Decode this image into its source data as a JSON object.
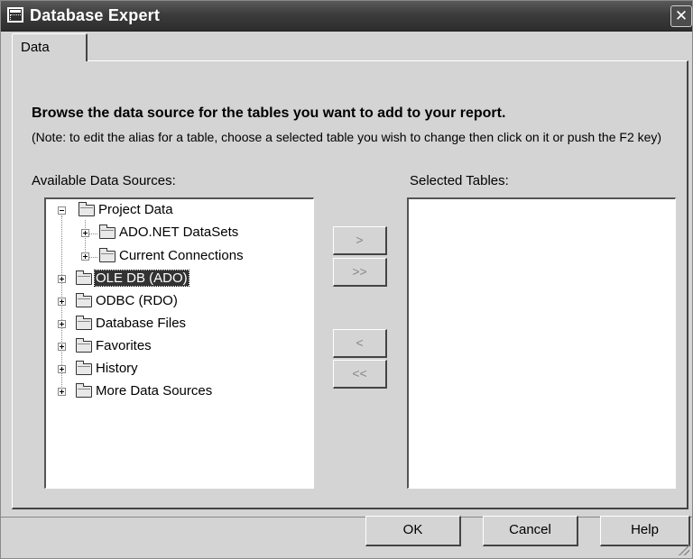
{
  "window": {
    "title": "Database Expert",
    "close_glyph": "✕"
  },
  "tabs": [
    {
      "label": "Data"
    }
  ],
  "main": {
    "heading": "Browse the data source for the tables you want to add to your report.",
    "note": "(Note: to edit the alias for a table, choose a selected table you wish to change then click on it or push the F2 key)",
    "available_label": "Available Data Sources:",
    "selected_label": "Selected Tables:"
  },
  "tree": {
    "items": [
      {
        "label": "Project Data",
        "expanded": true
      },
      {
        "label": "ADO.NET DataSets",
        "expanded": false
      },
      {
        "label": "Current Connections",
        "expanded": false
      },
      {
        "label": "OLE DB (ADO)",
        "expanded": false,
        "selected": true
      },
      {
        "label": "ODBC (RDO)",
        "expanded": false
      },
      {
        "label": "Database Files",
        "expanded": false
      },
      {
        "label": "Favorites",
        "expanded": false
      },
      {
        "label": "History",
        "expanded": false
      },
      {
        "label": "More Data Sources",
        "expanded": false
      }
    ]
  },
  "selected_tables": [],
  "transfer_buttons": {
    "add": ">",
    "add_all": ">>",
    "remove": "<",
    "remove_all": "<<"
  },
  "footer": {
    "ok": "OK",
    "cancel": "Cancel",
    "help": "Help"
  },
  "icons": {
    "folder": "folder-icon",
    "expand": "plus-box-icon",
    "collapse": "minus-box-icon"
  }
}
